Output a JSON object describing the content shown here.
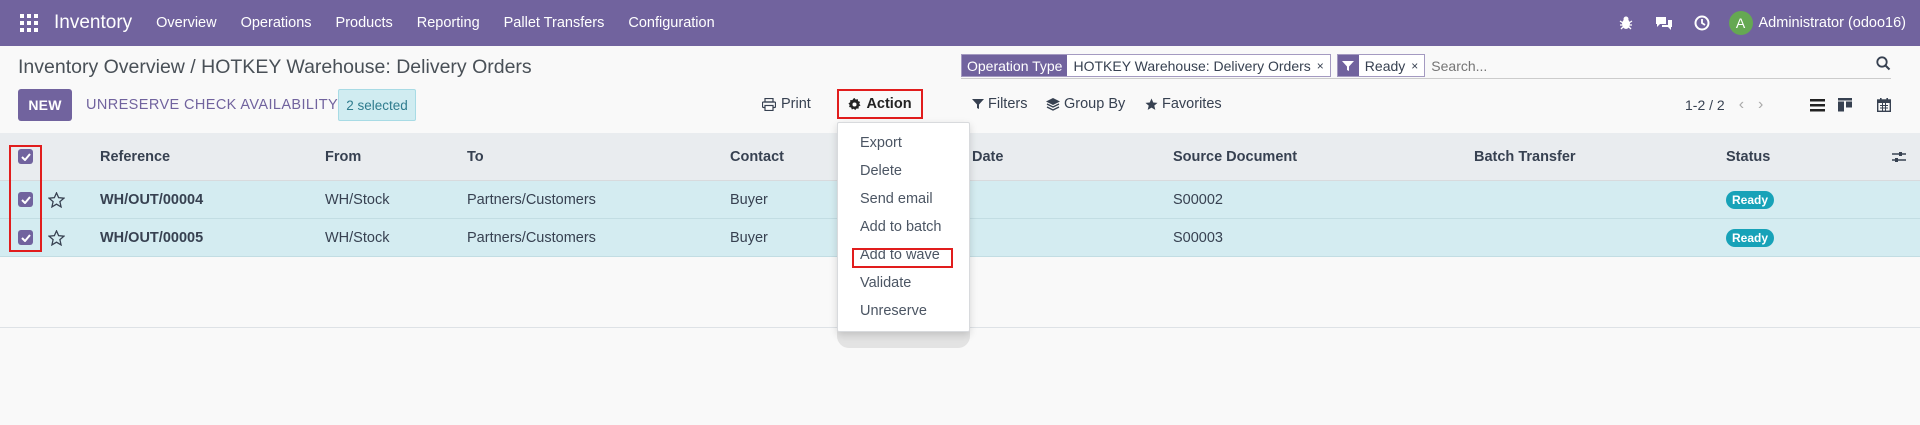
{
  "navbar": {
    "brand": "Inventory",
    "menu": [
      "Overview",
      "Operations",
      "Products",
      "Reporting",
      "Pallet Transfers",
      "Configuration"
    ],
    "avatar_letter": "A",
    "user": "Administrator (odoo16)"
  },
  "breadcrumb": "Inventory Overview / HOTKEY Warehouse: Delivery Orders",
  "search": {
    "facets": [
      {
        "label": "Operation Type",
        "value": "HOTKEY Warehouse: Delivery Orders"
      },
      {
        "label": "",
        "value": "Ready"
      }
    ],
    "placeholder": "Search...",
    "remove_glyph": "×"
  },
  "toolbar": {
    "new": "NEW",
    "unreserve": "UNRESERVE",
    "check_availability": "CHECK AVAILABILITY",
    "selected": "2 selected",
    "print": "Print",
    "action": "Action",
    "filters": "Filters",
    "group_by": "Group By",
    "favorites": "Favorites",
    "pager": "1-2 / 2"
  },
  "table": {
    "columns": [
      "Reference",
      "From",
      "To",
      "Contact",
      "Date",
      "Source Document",
      "Batch Transfer",
      "Status"
    ],
    "rows": [
      {
        "reference": "WH/OUT/00004",
        "from": "WH/Stock",
        "to": "Partners/Customers",
        "contact": "Buyer",
        "source": "S00002",
        "status": "Ready"
      },
      {
        "reference": "WH/OUT/00005",
        "from": "WH/Stock",
        "to": "Partners/Customers",
        "contact": "Buyer",
        "source": "S00003",
        "status": "Ready"
      }
    ]
  },
  "action_menu": [
    "Export",
    "Delete",
    "Send email",
    "Add to batch",
    "Add to wave",
    "Validate",
    "Unreserve"
  ],
  "colors": {
    "brand": "#71639e",
    "selected_row": "#d4ecf1",
    "ready": "#17a2b8",
    "highlight": "#e11d1d"
  }
}
